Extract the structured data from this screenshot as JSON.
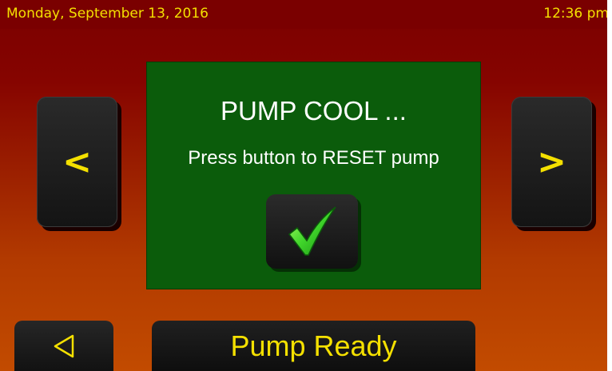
{
  "status_bar": {
    "date": "Monday, September 13, 2016",
    "time": "12:36 pm"
  },
  "nav": {
    "prev_label": "<",
    "next_label": ">"
  },
  "panel": {
    "title": "PUMP COOL ...",
    "message": "Press button to RESET pump",
    "confirm_icon": "checkmark-icon"
  },
  "footer": {
    "back_icon": "back-triangle-icon",
    "status": "Pump Ready"
  },
  "colors": {
    "accent_text": "#f4e000",
    "panel_bg": "#0b5c0b",
    "button_bg": "#1a1a1a",
    "bg_top": "#7a0000",
    "bg_bottom": "#c24b00"
  }
}
